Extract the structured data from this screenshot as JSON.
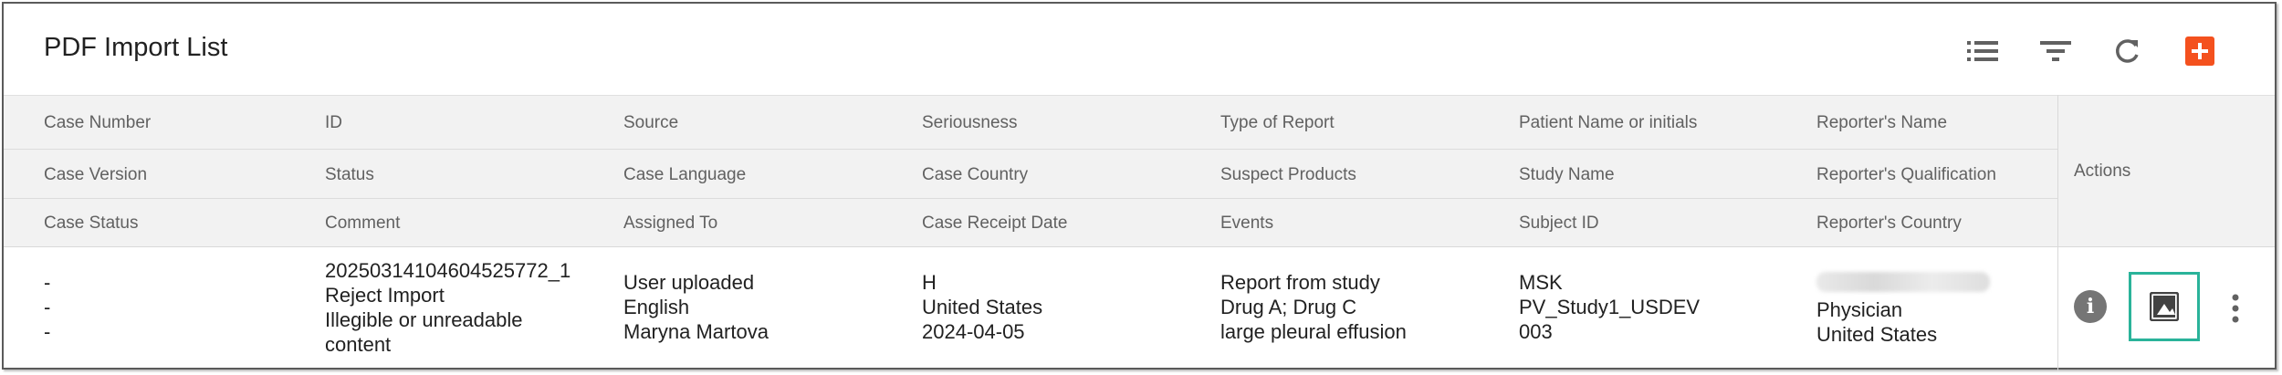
{
  "title": "PDF Import List",
  "toolbar": {
    "icons": [
      "list-icon",
      "filter-icon",
      "refresh-icon",
      "add-icon"
    ],
    "accent_color": "#f4511e"
  },
  "columns": [
    [
      "Case Number",
      "Case Version",
      "Case Status"
    ],
    [
      "ID",
      "Status",
      "Comment"
    ],
    [
      "Source",
      "Case Language",
      "Assigned To"
    ],
    [
      "Seriousness",
      "Case Country",
      "Case Receipt Date"
    ],
    [
      "Type of Report",
      "Suspect Products",
      "Events"
    ],
    [
      "Patient Name or initials",
      "Study Name",
      "Subject ID"
    ],
    [
      "Reporter's Name",
      "Reporter's Qualification",
      "Reporter's Country"
    ]
  ],
  "actions_header": "Actions",
  "row": {
    "case": [
      "-",
      "-",
      "-"
    ],
    "id": [
      "20250314104604525772_1",
      "Reject Import",
      "Illegible or unreadable content"
    ],
    "source": [
      "User uploaded",
      "English",
      "Maryna Martova"
    ],
    "seriousness": [
      "H",
      "United States",
      "2024-04-05"
    ],
    "report": [
      "Report from study",
      "Drug A; Drug C",
      "large pleural effusion"
    ],
    "patient": [
      "MSK",
      "PV_Study1_USDEV",
      "003"
    ],
    "reporter": [
      "",
      "Physician",
      "United States"
    ]
  },
  "row_actions": {
    "icons": [
      "info-icon",
      "image-icon",
      "more-vert-icon"
    ],
    "highlight_color": "#2ab39a"
  }
}
